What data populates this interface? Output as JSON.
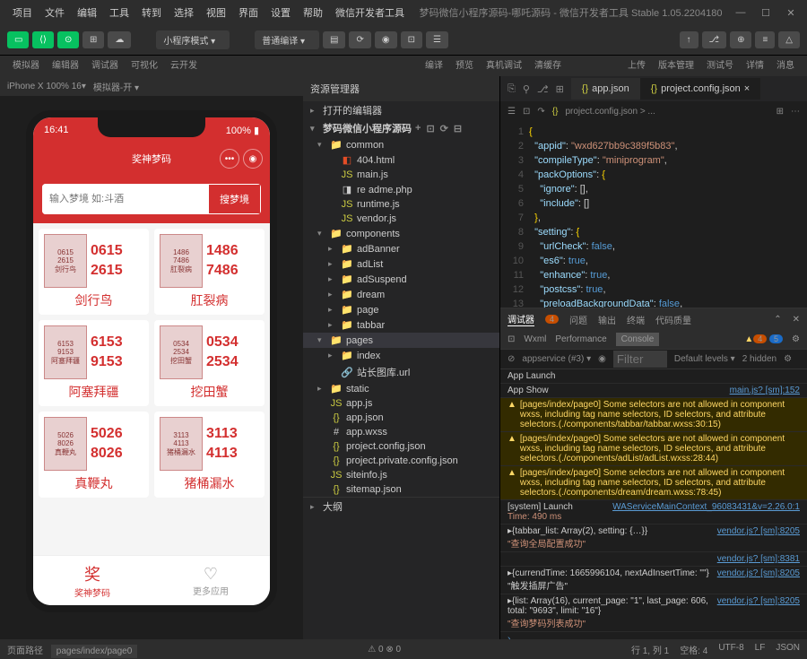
{
  "titlebar": {
    "menu": [
      "项目",
      "文件",
      "编辑",
      "工具",
      "转到",
      "选择",
      "视图",
      "界面",
      "设置",
      "帮助",
      "微信开发者工具"
    ],
    "title": "梦码微信小程序源码-哪吒源码 - 微信开发者工具 Stable 1.05.2204180"
  },
  "toolbar": {
    "labels": [
      "模拟器",
      "编辑器",
      "调试器",
      "可视化",
      "云开发"
    ],
    "mode": "小程序模式",
    "compile": "普通编译",
    "actions": [
      "编译",
      "预览",
      "真机调试",
      "清缓存"
    ],
    "right_actions": [
      "上传",
      "版本管理",
      "测试号",
      "详情",
      "消息"
    ]
  },
  "simulator": {
    "device": "iPhone X 100% 16",
    "time": "16:41",
    "battery": "100%",
    "nav_title": "奖神梦码",
    "search_placeholder": "输入梦境 如:斗酒",
    "search_btn": "搜梦境",
    "cards": [
      {
        "nums": [
          "0615",
          "2615"
        ],
        "title": "剑行鸟",
        "tag": "剑行鸟"
      },
      {
        "nums": [
          "1486",
          "7486"
        ],
        "title": "肛裂病",
        "tag": "肛裂病"
      },
      {
        "nums": [
          "6153",
          "9153"
        ],
        "title": "阿塞拜疆",
        "tag": "阿塞拜疆"
      },
      {
        "nums": [
          "0534",
          "2534"
        ],
        "title": "挖田蟹",
        "tag": "挖田蟹"
      },
      {
        "nums": [
          "5026",
          "8026"
        ],
        "title": "真鞭丸",
        "tag": "真鞭丸"
      },
      {
        "nums": [
          "3113",
          "4113"
        ],
        "title": "猪桶漏水",
        "tag": "猪桶漏水"
      }
    ],
    "tabbar": [
      {
        "icon": "奖",
        "label": "奖神梦码"
      },
      {
        "icon": "♡",
        "label": "更多应用"
      }
    ]
  },
  "explorer": {
    "title": "资源管理器",
    "open_editors": "打开的编辑器",
    "root": "梦码微信小程序源码",
    "tree": [
      {
        "type": "folder",
        "name": "common",
        "open": true,
        "children": [
          {
            "type": "file",
            "name": "404.html",
            "icon": "html"
          },
          {
            "type": "file",
            "name": "main.js",
            "icon": "js"
          },
          {
            "type": "file",
            "name": "re adme.php",
            "icon": "php"
          },
          {
            "type": "file",
            "name": "runtime.js",
            "icon": "js"
          },
          {
            "type": "file",
            "name": "vendor.js",
            "icon": "js"
          }
        ]
      },
      {
        "type": "folder",
        "name": "components",
        "open": true,
        "children": [
          {
            "type": "folder",
            "name": "adBanner"
          },
          {
            "type": "folder",
            "name": "adList"
          },
          {
            "type": "folder",
            "name": "adSuspend"
          },
          {
            "type": "folder",
            "name": "dream"
          },
          {
            "type": "folder",
            "name": "page"
          },
          {
            "type": "folder",
            "name": "tabbar"
          }
        ]
      },
      {
        "type": "folder",
        "name": "pages",
        "open": true,
        "selected": true,
        "children": [
          {
            "type": "folder",
            "name": "index"
          },
          {
            "type": "file",
            "name": "站长图库.url",
            "icon": "url"
          }
        ]
      },
      {
        "type": "folder",
        "name": "static"
      },
      {
        "type": "file",
        "name": "app.js",
        "icon": "js"
      },
      {
        "type": "file",
        "name": "app.json",
        "icon": "json"
      },
      {
        "type": "file",
        "name": "app.wxss",
        "icon": "wxss"
      },
      {
        "type": "file",
        "name": "project.config.json",
        "icon": "json"
      },
      {
        "type": "file",
        "name": "project.private.config.json",
        "icon": "json"
      },
      {
        "type": "file",
        "name": "siteinfo.js",
        "icon": "js"
      },
      {
        "type": "file",
        "name": "sitemap.json",
        "icon": "json"
      }
    ],
    "outline": "大纲"
  },
  "editor": {
    "tabs": [
      "app.json",
      "project.config.json"
    ],
    "active_tab": "project.config.json",
    "breadcrumb": "project.config.json > ...",
    "code_lines": [
      "{",
      "  \"appid\": \"wxd627bb9c389f5b83\",",
      "  \"compileType\": \"miniprogram\",",
      "  \"packOptions\": {",
      "    \"ignore\": [],",
      "    \"include\": []",
      "  },",
      "  \"setting\": {",
      "    \"urlCheck\": false,",
      "    \"es6\": true,",
      "    \"enhance\": true,",
      "    \"postcss\": true,",
      "    \"preloadBackgroundData\": false,"
    ]
  },
  "console": {
    "main_tabs": [
      "调试器",
      "问题",
      "输出",
      "终端",
      "代码质量"
    ],
    "issue_badge": "4",
    "sub_tabs": [
      "Wxml",
      "Performance",
      "Console"
    ],
    "filter_label": "Filter",
    "levels": "Default levels",
    "hidden": "2 hidden",
    "top_dropdown": "appservice (#3)",
    "warn_a": "4",
    "warn_b": "5",
    "app_launch": "App Launch",
    "app_show": "App Show",
    "app_show_src": "main.js? [sm]:152",
    "warnings": [
      {
        "msg": "[pages/index/page0] Some selectors are not allowed in component wxss, including tag name selectors, ID selectors, and attribute selectors.(./components/tabbar/tabbar.wxss:30:15)"
      },
      {
        "msg": "[pages/index/page0] Some selectors are not allowed in component wxss, including tag name selectors, ID selectors, and attribute selectors.(./components/adList/adList.wxss:28:44)"
      },
      {
        "msg": "[pages/index/page0] Some selectors are not allowed in component wxss, including tag name selectors, ID selectors, and attribute selectors.(./components/dream/dream.wxss:78:45)"
      }
    ],
    "logs": [
      {
        "msg": "[system] Launch",
        "extra": "WAServiceMainContext_96083431&v=2.26.0:1",
        "sub": "Time: 490 ms"
      },
      {
        "msg": "▸{tabbar_list: Array(2), setting: {…}}",
        "src": "vendor.js? [sm]:8205",
        "sub": "\"查询全局配置成功\""
      },
      {
        "msg": "",
        "src": "vendor.js? [sm]:8381"
      },
      {
        "msg": "▸{currendTime: 1665996104, nextAdInsertTime: \"\"} \"触发插屏广告\"",
        "src": "vendor.js? [sm]:8205"
      },
      {
        "msg": "▸{list: Array(16), current_page: \"1\", last_page: 606, total: \"9693\", limit: \"16\"}",
        "src": "vendor.js? [sm]:8205",
        "sub": "\"查询梦码列表成功\""
      }
    ]
  },
  "statusbar": {
    "left": "页面路径",
    "path": "pages/index/page0",
    "right": [
      "行 1, 列 1",
      "空格: 4",
      "UTF-8",
      "LF",
      "JSON"
    ]
  }
}
